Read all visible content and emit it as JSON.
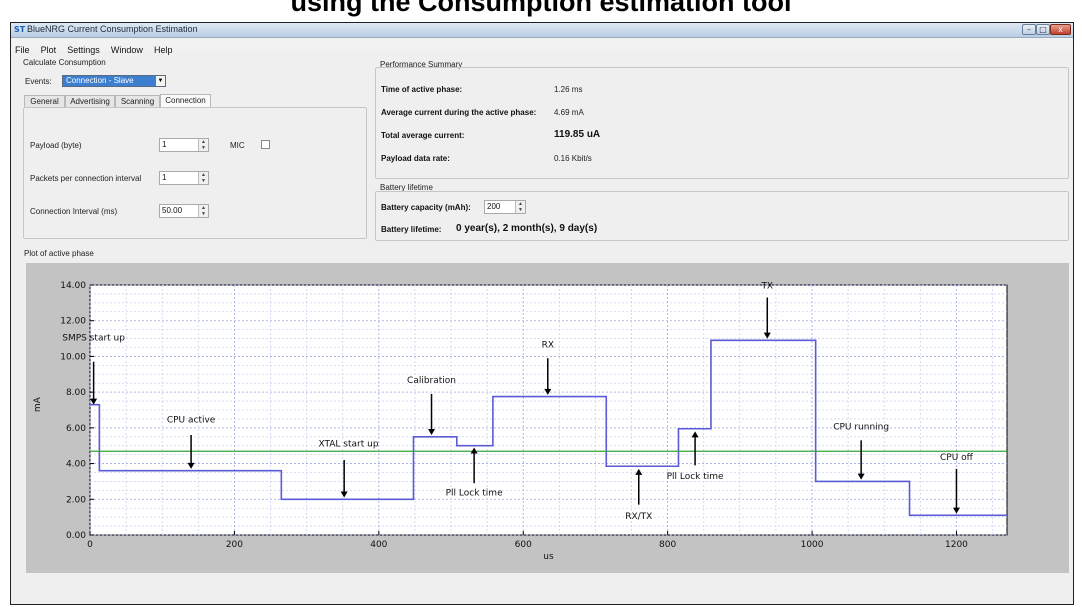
{
  "page": {
    "heading": "using the Consumption estimation tool"
  },
  "window": {
    "title": "BlueNRG Current Consumption Estimation",
    "app_icon": "blue-nrg-app-icon",
    "controls": [
      "minimize-icon",
      "maximize-icon",
      "close-icon"
    ]
  },
  "menu": [
    "File",
    "Plot",
    "Settings",
    "Window",
    "Help"
  ],
  "calc": {
    "title": "Calculate Consumption",
    "events_label": "Events:",
    "events_value": "Connection - Slave",
    "tabs": [
      "General",
      "Advertising",
      "Scanning",
      "Connection"
    ],
    "active_tab": "Connection",
    "payload_label": "Payload (byte)",
    "payload_value": "1",
    "mic_label": "MIC",
    "packets_label": "Packets per connection interval",
    "packets_value": "1",
    "interval_label": "Connection Interval (ms)",
    "interval_value": "50.00"
  },
  "perf": {
    "title": "Performance Summary",
    "rows": [
      {
        "label": "Time of active phase:",
        "value": "1.26 ms"
      },
      {
        "label": "Average current during the active phase:",
        "value": "4.69 mA"
      },
      {
        "label": "Total average current:",
        "value": "119.85 uA"
      },
      {
        "label": "Payload data rate:",
        "value": "0.16 Kbit/s"
      }
    ]
  },
  "battery": {
    "title": "Battery lifetime",
    "capacity_label": "Battery capacity (mAh):",
    "capacity_value": "200",
    "lifetime_label": "Battery lifetime:",
    "lifetime_value": "0 year(s), 2 month(s), 9 day(s)"
  },
  "plot": {
    "title": "Plot of active phase"
  },
  "chart_data": {
    "type": "line",
    "xlabel": "us",
    "ylabel": "mA",
    "xlim": [
      0,
      1270
    ],
    "ylim": [
      0,
      14
    ],
    "x_ticks": [
      "0",
      "200",
      "400",
      "600",
      "800",
      "1000",
      "1200"
    ],
    "y_ticks": [
      "0.00",
      "2.00",
      "4.00",
      "6.00",
      "8.00",
      "10.00",
      "12.00",
      "14.00"
    ],
    "grid": true,
    "series": [
      {
        "name": "",
        "color": "#5b5bd8",
        "x": [
          0,
          13,
          13,
          265,
          265,
          448,
          448,
          508,
          508,
          558,
          558,
          715,
          715,
          815,
          815,
          860,
          860,
          1005,
          1005,
          1135,
          1135,
          1270
        ],
        "y": [
          7.3,
          7.3,
          3.6,
          3.6,
          2.0,
          2.0,
          5.5,
          5.5,
          5.0,
          5.0,
          7.75,
          7.75,
          3.85,
          3.85,
          5.95,
          5.95,
          10.9,
          10.9,
          3.0,
          3.0,
          1.1,
          1.1
        ]
      },
      {
        "name": "",
        "color": "#3aa33a",
        "x": [
          0,
          1270
        ],
        "y": [
          4.69,
          4.69
        ]
      }
    ],
    "annotations": [
      {
        "text": "SMPS start up",
        "x": 5,
        "y": 10.9,
        "arrow_x": 5,
        "arrow_top": 9.7,
        "arrow_tip": 7.3
      },
      {
        "text": "CPU active",
        "x": 140,
        "y": 6.3,
        "arrow_x": 140,
        "arrow_top": 5.6,
        "arrow_tip": 3.7
      },
      {
        "text": "XTAL start up",
        "x": 358,
        "y": 4.95,
        "arrow_x": 352,
        "arrow_top": 4.2,
        "arrow_tip": 2.1
      },
      {
        "text": "Calibration",
        "x": 473,
        "y": 8.5,
        "arrow_x": 473,
        "arrow_top": 7.9,
        "arrow_tip": 5.6
      },
      {
        "text": "RX",
        "x": 634,
        "y": 10.5,
        "arrow_x": 634,
        "arrow_top": 9.9,
        "arrow_tip": 7.85
      },
      {
        "text": "Pll Lock time",
        "x": 532,
        "y": 2.2,
        "arrow_x": 532,
        "arrow_top": 2.9,
        "arrow_tip": 4.9
      },
      {
        "text": "RX/TX",
        "x": 760,
        "y": 0.9,
        "arrow_x": 760,
        "arrow_top": 1.7,
        "arrow_tip": 3.7
      },
      {
        "text": "Pll Lock time",
        "x": 838,
        "y": 3.15,
        "arrow_x": 838,
        "arrow_top": 3.9,
        "arrow_tip": 5.8
      },
      {
        "text": "TX",
        "x": 938,
        "y": 13.8,
        "arrow_x": 938,
        "arrow_top": 13.3,
        "arrow_tip": 11.0
      },
      {
        "text": "CPU running",
        "x": 1068,
        "y": 5.9,
        "arrow_x": 1068,
        "arrow_top": 5.3,
        "arrow_tip": 3.1
      },
      {
        "text": "CPU off",
        "x": 1200,
        "y": 4.2,
        "arrow_x": 1200,
        "arrow_top": 3.7,
        "arrow_tip": 1.2
      }
    ]
  }
}
